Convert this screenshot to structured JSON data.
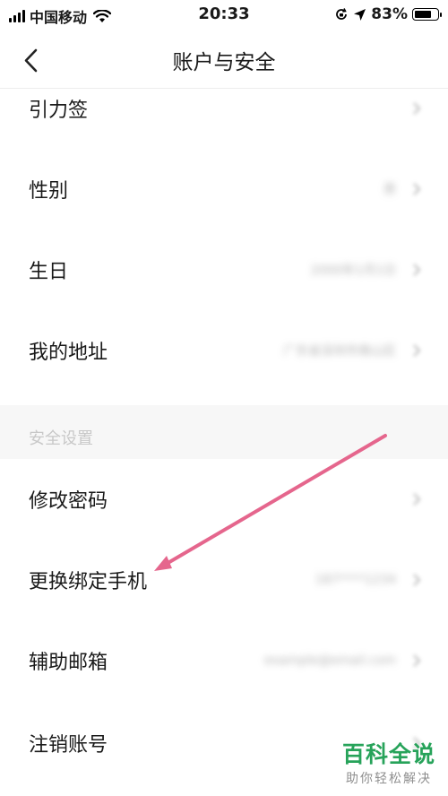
{
  "status_bar": {
    "carrier": "中国移动",
    "time": "20:33",
    "battery": "83%",
    "battery_level": 0.83,
    "icons": [
      "signal-icon",
      "wifi-icon",
      "orientation-lock-icon",
      "location-icon",
      "battery-icon"
    ]
  },
  "nav": {
    "title": "账户与安全",
    "back_icon": "chevron-left-icon"
  },
  "rows": [
    {
      "label": "引力签",
      "value": ""
    },
    {
      "label": "性别",
      "value": "男"
    },
    {
      "label": "生日",
      "value": "2000年1月1日"
    },
    {
      "label": "我的地址",
      "value": "广东省深圳市南山区"
    }
  ],
  "security_section": {
    "title": "安全设置",
    "rows": [
      {
        "label": "修改密码",
        "value": ""
      },
      {
        "label": "更换绑定手机",
        "value": "187****1234"
      },
      {
        "label": "辅助邮箱",
        "value": "example@email.com"
      },
      {
        "label": "注销账号",
        "value": ""
      }
    ]
  },
  "annotation": {
    "arrow_color": "#e5668d"
  },
  "watermark": {
    "title": "百科全说",
    "subtitle": "助你轻松解决"
  },
  "colors": {
    "accent_green": "#27a35a",
    "divider": "#ededed",
    "section_bg": "#f7f7f7"
  }
}
